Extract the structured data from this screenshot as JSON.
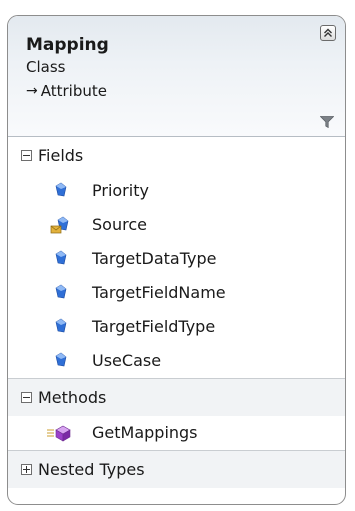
{
  "class": {
    "name": "Mapping",
    "kind": "Class",
    "base_arrow": "→",
    "base": "Attribute"
  },
  "icons": {
    "collapse": "double-chevron-up-icon",
    "filter": "funnel-icon",
    "field": "field-diamond-icon",
    "protected_field": "protected-field-envelope-icon",
    "method": "method-cube-icon"
  },
  "colors": {
    "field_icon": "#2f6fd6",
    "method_icon": "#9b40c9",
    "envelope": "#e3b23c",
    "border": "#8d8d8d"
  },
  "sections": {
    "fields": {
      "label": "Fields",
      "expanded": true,
      "items": [
        {
          "name": "Priority",
          "access": "public"
        },
        {
          "name": "Source",
          "access": "protected"
        },
        {
          "name": "TargetDataType",
          "access": "public"
        },
        {
          "name": "TargetFieldName",
          "access": "public"
        },
        {
          "name": "TargetFieldType",
          "access": "public"
        },
        {
          "name": "UseCase",
          "access": "public"
        }
      ]
    },
    "methods": {
      "label": "Methods",
      "expanded": true,
      "items": [
        {
          "name": "GetMappings",
          "access": "public"
        }
      ]
    },
    "nested_types": {
      "label": "Nested Types",
      "expanded": false
    }
  }
}
